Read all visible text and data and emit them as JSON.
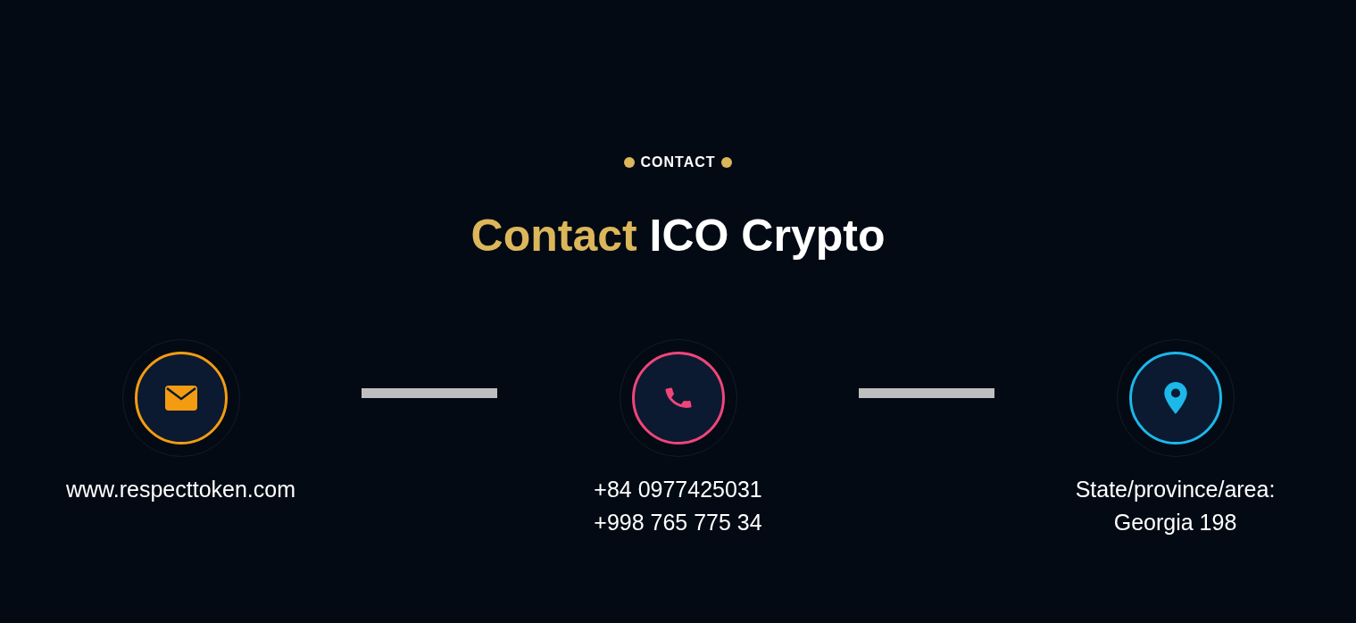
{
  "section_label": "CONTACT",
  "heading": {
    "highlight": "Contact",
    "rest": "ICO Crypto"
  },
  "contacts": [
    {
      "kind": "email",
      "color": "#f39c12",
      "lines": [
        "www.respecttoken.com"
      ]
    },
    {
      "kind": "phone",
      "color": "#f0457b",
      "lines": [
        "+84 0977425031",
        "+998 765 775 34"
      ]
    },
    {
      "kind": "location",
      "color": "#1cb8ea",
      "lines": [
        "State/province/area:",
        "Georgia 198"
      ]
    }
  ]
}
